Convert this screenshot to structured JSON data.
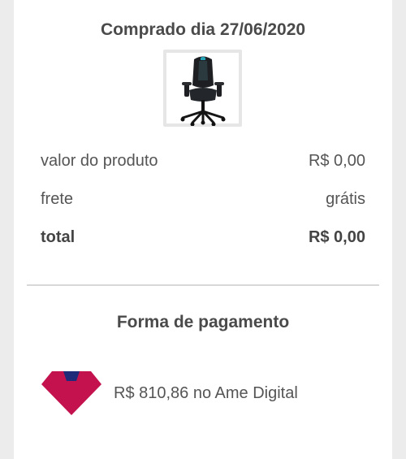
{
  "order": {
    "purchase_date_label": "Comprado dia 27/06/2020"
  },
  "product": {
    "image_icon": "gaming-chair-icon"
  },
  "summary": {
    "rows": [
      {
        "label": "valor do produto",
        "value": "R$ 0,00"
      },
      {
        "label": "frete",
        "value": "grátis"
      },
      {
        "label": "total",
        "value": "R$ 0,00"
      }
    ]
  },
  "payment": {
    "heading": "Forma de pagamento",
    "method_icon": "ame-digital-logo",
    "method_text": "R$ 810,86 no Ame Digital",
    "logo_colors": {
      "main": "#c4124f",
      "accent": "#1f2a78"
    }
  }
}
